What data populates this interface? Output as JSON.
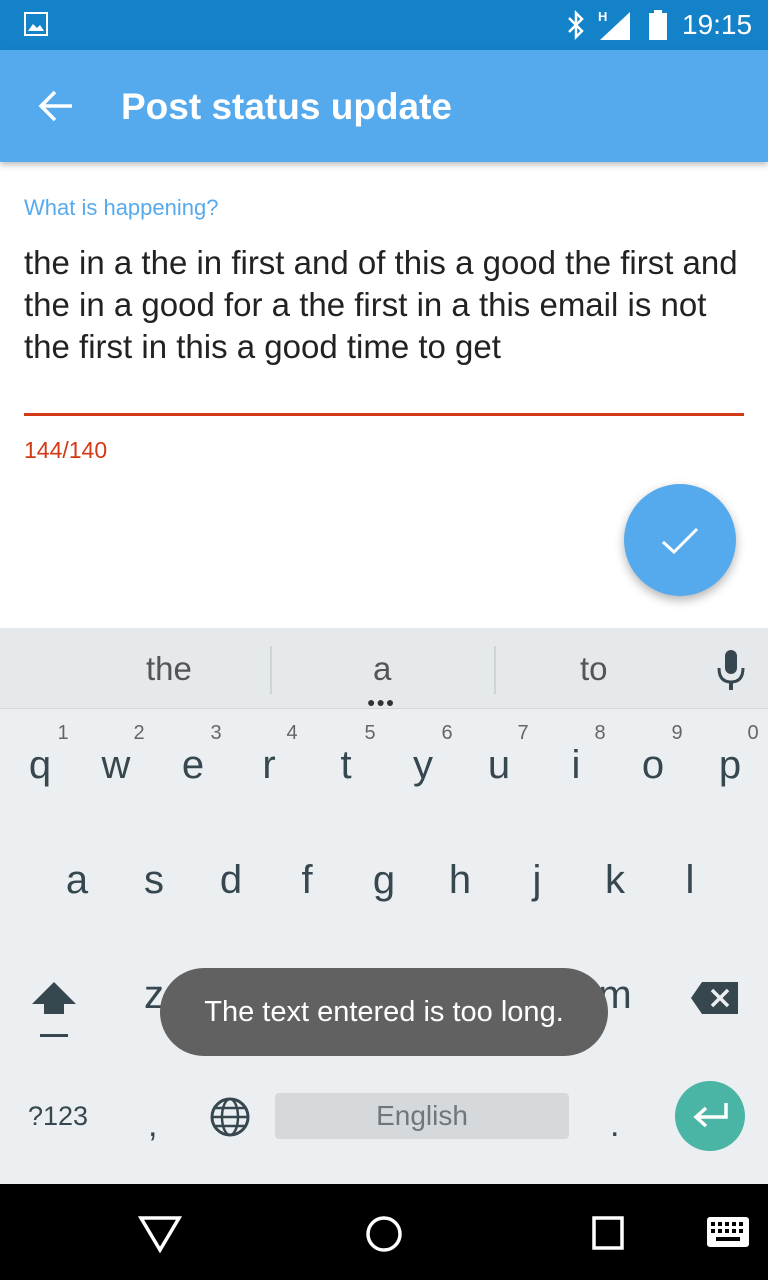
{
  "status_bar": {
    "time": "19:15",
    "icons": [
      "image-icon",
      "bluetooth-icon",
      "signal-h-icon",
      "battery-icon"
    ]
  },
  "app_bar": {
    "title": "Post status update",
    "back_icon": "arrow-left-icon",
    "color": "#55aaee"
  },
  "compose": {
    "hint_label": "What is happening?",
    "text": "the in a the in first and of this a good the first and the in a good for a the first in a this email is not the first in this a good time to get",
    "counter": "144/140",
    "error_color": "#d13a14",
    "fab_icon": "check-icon"
  },
  "keyboard": {
    "suggestions": [
      "the",
      "a",
      "to"
    ],
    "mic_icon": "microphone-icon",
    "row1_keys": [
      "q",
      "w",
      "e",
      "r",
      "t",
      "y",
      "u",
      "i",
      "o",
      "p"
    ],
    "row1_hints": [
      "1",
      "2",
      "3",
      "4",
      "5",
      "6",
      "7",
      "8",
      "9",
      "0"
    ],
    "row2_keys": [
      "a",
      "s",
      "d",
      "f",
      "g",
      "h",
      "j",
      "k",
      "l"
    ],
    "row3_visible": {
      "z": "z",
      "m": "m"
    },
    "symbols_key": "?123",
    "comma_key": ",",
    "space_label": "English",
    "period_key": ".",
    "enter_color": "#4ab5a4"
  },
  "toast": {
    "message": "The text entered is too long."
  },
  "nav_bar": {
    "icons": [
      "back-triangle-icon",
      "home-circle-icon",
      "recents-square-icon",
      "keyboard-icon"
    ]
  }
}
